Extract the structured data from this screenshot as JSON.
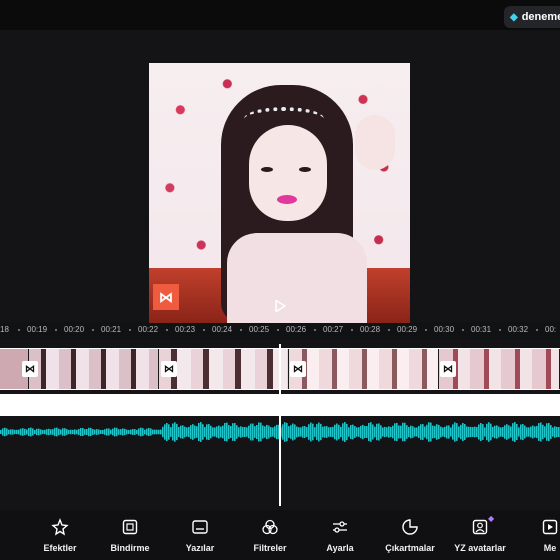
{
  "header": {
    "trial_label": "deneme",
    "accent_color": "#3fd3f0"
  },
  "preview": {
    "watermark_icon": "capcut-logo-icon",
    "play_icon": "play-icon"
  },
  "ruler": {
    "ticks": [
      "18",
      "00:19",
      "00:20",
      "00:21",
      "00:22",
      "00:23",
      "00:24",
      "00:25",
      "00:26",
      "00:27",
      "00:28",
      "00:29",
      "00:30",
      "00:31",
      "00:32",
      "00:"
    ]
  },
  "timeline": {
    "audio_color": "#1fc4c8",
    "transition_icon": "transition-icon"
  },
  "toolbar": {
    "items": [
      {
        "label": "Efektler",
        "icon": "effects-star-icon"
      },
      {
        "label": "Bindirme",
        "icon": "overlay-icon"
      },
      {
        "label": "Yazılar",
        "icon": "text-icon"
      },
      {
        "label": "Filtreler",
        "icon": "filters-icon"
      },
      {
        "label": "Ayarla",
        "icon": "adjust-sliders-icon"
      },
      {
        "label": "Çıkartmalar",
        "icon": "stickers-icon"
      },
      {
        "label": "YZ avatarlar",
        "icon": "ai-avatar-icon"
      },
      {
        "label": "Me",
        "icon": "media-icon"
      }
    ]
  }
}
